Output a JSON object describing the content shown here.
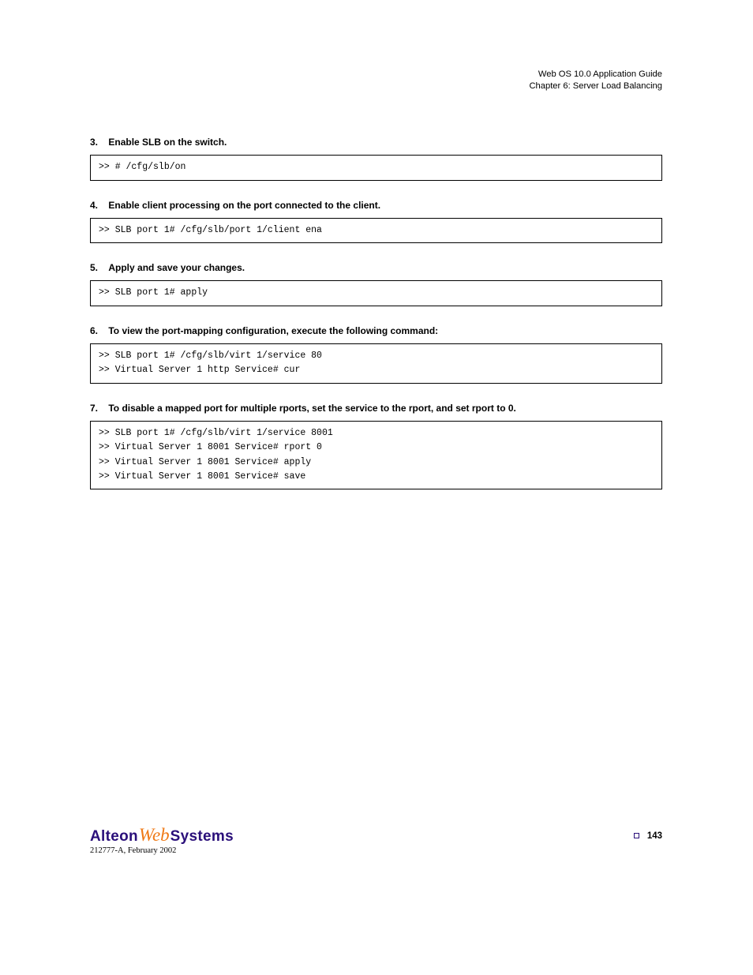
{
  "header": {
    "title": "Web OS 10.0 Application Guide",
    "subtitle": "Chapter 6: Server Load Balancing"
  },
  "steps": [
    {
      "num": "3.",
      "head": "Enable SLB on the switch.",
      "cmd": ">> # /cfg/slb/on"
    },
    {
      "num": "4.",
      "head": "Enable client processing on the port connected to the client.",
      "cmd": ">> SLB port 1# /cfg/slb/port 1/client ena"
    },
    {
      "num": "5.",
      "head": "Apply and save your changes.",
      "cmd": ">> SLB port 1# apply"
    },
    {
      "num": "6.",
      "head": "To view the port-mapping configuration, execute the following command:",
      "cmd": ">> SLB port 1# /cfg/slb/virt 1/service 80\n>> Virtual Server 1 http Service# cur"
    },
    {
      "num": "7.",
      "head": "To disable a mapped port for multiple rports, set the service to the rport, and set rport  to 0.",
      "cmd": ">> SLB port 1# /cfg/slb/virt 1/service 8001\n>> Virtual Server 1 8001 Service# rport 0\n>> Virtual Server 1 8001 Service# apply\n>> Virtual Server 1 8001 Service# save"
    }
  ],
  "logo": {
    "alteon": "Alteon",
    "web": "Web",
    "systems": "Systems"
  },
  "footer": {
    "pagenum": "143",
    "docid": "212777-A, February 2002"
  }
}
